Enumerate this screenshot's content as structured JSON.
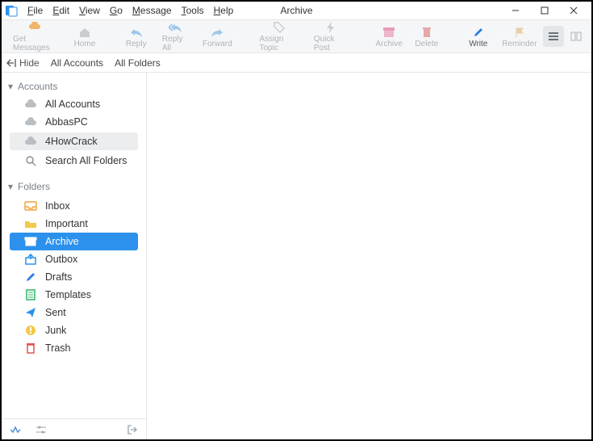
{
  "title": "Archive",
  "menu": {
    "file": "File",
    "edit": "Edit",
    "view": "View",
    "go": "Go",
    "message": "Message",
    "tools": "Tools",
    "help": "Help"
  },
  "toolbar": {
    "get_messages": "Get Messages",
    "home": "Home",
    "reply": "Reply",
    "reply_all": "Reply All",
    "forward": "Forward",
    "assign_topic": "Assign Topic",
    "quick_post": "Quick Post",
    "archive": "Archive",
    "delete": "Delete",
    "write": "Write",
    "reminder": "Reminder"
  },
  "filterbar": {
    "hide": "Hide",
    "all_accounts": "All Accounts",
    "all_folders": "All Folders"
  },
  "sections": {
    "accounts": "Accounts",
    "folders": "Folders"
  },
  "accounts": {
    "all": "All Accounts",
    "a1": "AbbasPC",
    "a2": "4HowCrack",
    "search": "Search All Folders"
  },
  "folders": {
    "inbox": "Inbox",
    "important": "Important",
    "archive": "Archive",
    "outbox": "Outbox",
    "drafts": "Drafts",
    "templates": "Templates",
    "sent": "Sent",
    "junk": "Junk",
    "trash": "Trash"
  }
}
